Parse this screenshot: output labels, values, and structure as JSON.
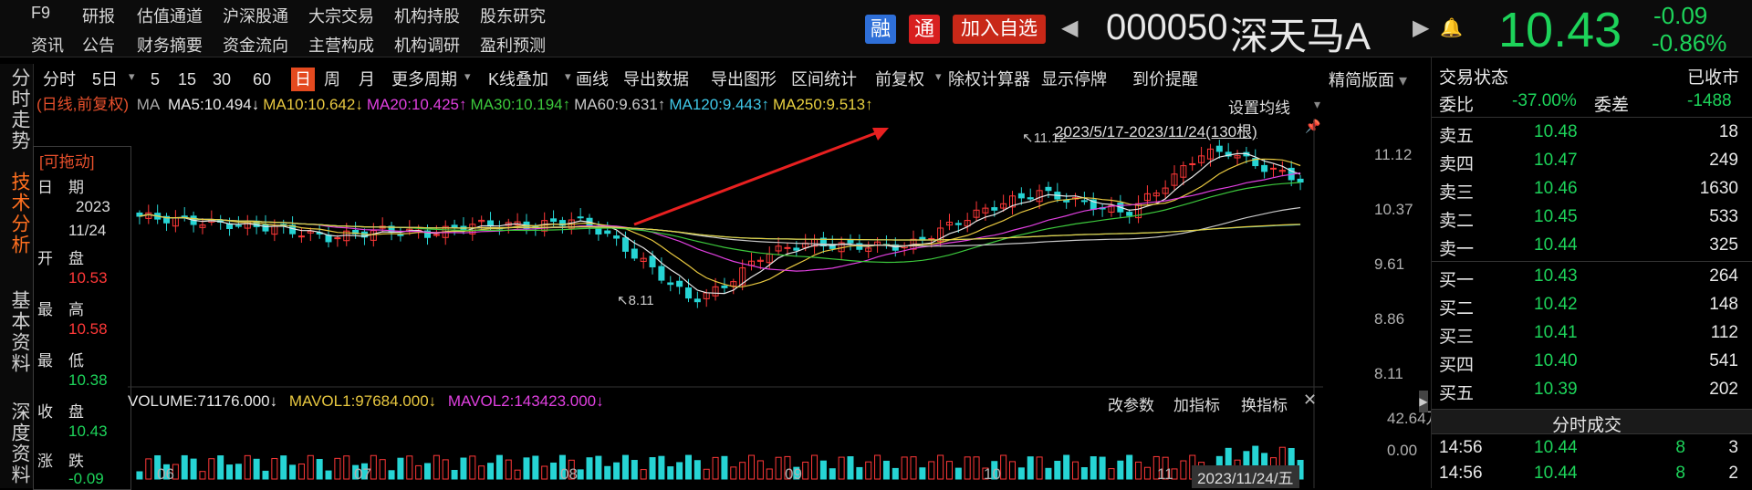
{
  "menu": {
    "row1": [
      "F9",
      "研报",
      "估值通道",
      "沪深股通",
      "大宗交易",
      "机构持股",
      "股东研究"
    ],
    "row2": [
      "资讯",
      "公告",
      "财务摘要",
      "资金流向",
      "主营构成",
      "机构调研",
      "盈利预测"
    ]
  },
  "badges": {
    "rong": "融",
    "tong": "通",
    "add_fav": "加入自选"
  },
  "stock": {
    "code": "000050",
    "name": "深天马A",
    "price": "10.43",
    "change": "-0.09",
    "change_pct": "-0.86%"
  },
  "left_nav": [
    "分时走势",
    "技术分析",
    "基本资料",
    "深度资料"
  ],
  "toolbar": {
    "items": [
      "分时",
      "5日",
      "5",
      "15",
      "30",
      "60",
      "日",
      "周",
      "月",
      "更多周期",
      "K线叠加",
      "画线",
      "导出数据",
      "导出图形",
      "区间统计",
      "前复权",
      "除权计算器",
      "显示停牌",
      "到价提醒"
    ],
    "mode_btn": "精简版面"
  },
  "ma_legend": {
    "prefix": "(日线,前复权)",
    "ma": "MA",
    "items": [
      {
        "label": "MA5:10.494↓",
        "color": "#e8e8e8"
      },
      {
        "label": "MA10:10.642↓",
        "color": "#e8c840"
      },
      {
        "label": "MA20:10.425↑",
        "color": "#e040e0"
      },
      {
        "label": "MA30:10.194↑",
        "color": "#3cc83c"
      },
      {
        "label": "MA60:9.631↑",
        "color": "#c8c8c8"
      },
      {
        "label": "MA120:9.443↑",
        "color": "#40c8e8"
      },
      {
        "label": "MA250:9.513↑",
        "color": "#e8d040"
      }
    ],
    "settings": "设置均线"
  },
  "range_label": "2023/5/17-2023/11/24(130根)",
  "info_panel": {
    "draggable": "[可拖动]",
    "date_label": "日　期",
    "year": "2023",
    "date": "11/24",
    "open_label": "开　盘",
    "open": "10.53",
    "high_label": "最　高",
    "high": "10.58",
    "low_label": "最　低",
    "low": "10.38",
    "close_label": "收　盘",
    "close": "10.43",
    "change_label": "涨　跌",
    "change": "-0.09"
  },
  "price_axis": [
    "11.12",
    "10.37",
    "9.61",
    "8.86",
    "8.11"
  ],
  "annotations": {
    "high": "11.12",
    "low": "8.11"
  },
  "volume": {
    "label": "VOLUME:71176.000↓",
    "mavol1": "MAVOL1:97684.000↓",
    "mavol2": "MAVOL2:143423.000↓",
    "axis_top": "42.64万",
    "axis_bottom": "0.00",
    "buttons": [
      "改参数",
      "加指标",
      "换指标"
    ]
  },
  "x_axis": [
    "06",
    "07",
    "08",
    "09",
    "10",
    "11"
  ],
  "cursor_date": "2023/11/24/五",
  "order_book": {
    "status_label": "交易状态",
    "status_value": "已收市",
    "ratio_label": "委比",
    "ratio_value": "-37.00%",
    "diff_label": "委差",
    "diff_value": "-1488",
    "asks": [
      {
        "label": "卖五",
        "price": "10.48",
        "vol": "18"
      },
      {
        "label": "卖四",
        "price": "10.47",
        "vol": "249"
      },
      {
        "label": "卖三",
        "price": "10.46",
        "vol": "1630"
      },
      {
        "label": "卖二",
        "price": "10.45",
        "vol": "533"
      },
      {
        "label": "卖一",
        "price": "10.44",
        "vol": "325"
      }
    ],
    "bids": [
      {
        "label": "买一",
        "price": "10.43",
        "vol": "264"
      },
      {
        "label": "买二",
        "price": "10.42",
        "vol": "148"
      },
      {
        "label": "买三",
        "price": "10.41",
        "vol": "112"
      },
      {
        "label": "买四",
        "price": "10.40",
        "vol": "541"
      },
      {
        "label": "买五",
        "price": "10.39",
        "vol": "202"
      }
    ]
  },
  "ticks": {
    "title": "分时成交",
    "rows": [
      {
        "time": "14:56",
        "price": "10.44",
        "vol": "8",
        "count": "3"
      },
      {
        "time": "14:56",
        "price": "10.44",
        "vol": "8",
        "count": "2"
      }
    ]
  },
  "chart_data": {
    "type": "candlestick",
    "date_range": "2023/5/17-2023/11/24",
    "bars": 130,
    "price_range": [
      8.11,
      11.12
    ],
    "y_ticks": [
      11.12,
      10.37,
      9.61,
      8.86,
      8.11
    ],
    "x_ticks": [
      "06",
      "07",
      "08",
      "09",
      "10",
      "11"
    ],
    "last": {
      "date": "2023/11/24",
      "open": 10.53,
      "high": 10.58,
      "low": 10.38,
      "close": 10.43
    },
    "volume_axis": [
      "42.64万",
      "0.00"
    ]
  }
}
